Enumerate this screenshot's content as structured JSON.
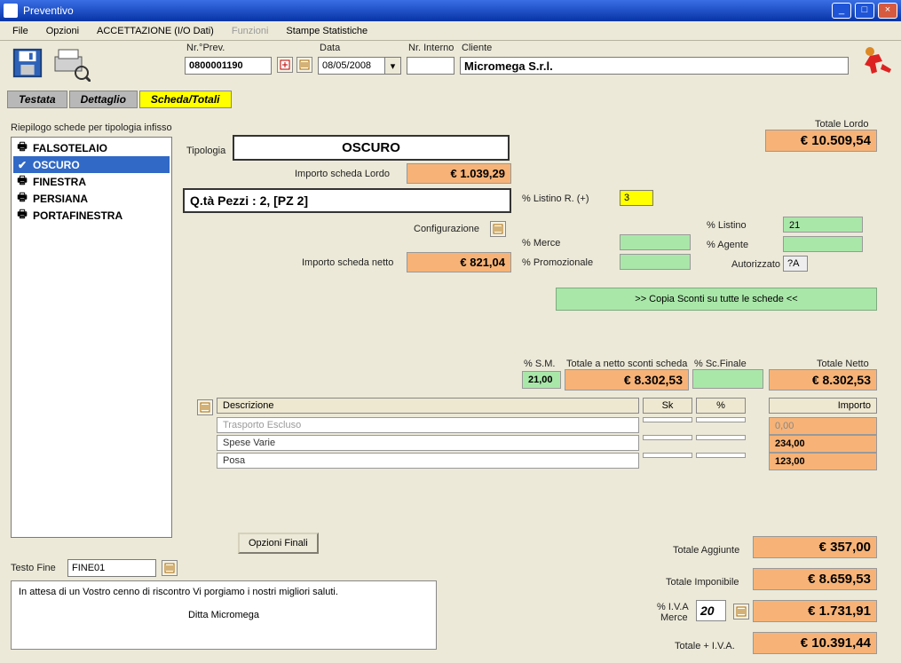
{
  "window": {
    "title": "Preventivo"
  },
  "menu": {
    "file": "File",
    "opzioni": "Opzioni",
    "accett": "ACCETTAZIONE (I/O Dati)",
    "funzioni": "Funzioni",
    "stampe": "Stampe Statistiche"
  },
  "top": {
    "nr_prev_label": "Nr.°Prev.",
    "nr_prev": "0800001190",
    "data_label": "Data",
    "data": "08/05/2008",
    "nr_interno_label": "Nr. Interno",
    "nr_interno": "",
    "cliente_label": "Cliente",
    "cliente": "Micromega S.r.l."
  },
  "tabs": {
    "testata": "Testata",
    "dettaglio": "Dettaglio",
    "scheda": "Scheda/Totali"
  },
  "sidebar": {
    "title": "Riepilogo schede per tipologia infisso",
    "items": [
      "FALSOTELAIO",
      "OSCURO",
      "FINESTRA",
      "PERSIANA",
      "PORTAFINESTRA"
    ],
    "selected_index": 1
  },
  "scheda": {
    "tipologia_label": "Tipologia",
    "tipologia": "OSCURO",
    "imp_lordo_label": "Importo scheda Lordo",
    "imp_lordo": "€ 1.039,29",
    "qta": "Q.tà Pezzi : 2,  [PZ 2]",
    "configurazione": "Configurazione",
    "imp_netto_label": "Importo scheda netto",
    "imp_netto": "€ 821,04"
  },
  "sconti": {
    "listino_r_label": "% Listino R. (+)",
    "listino_r": "3",
    "merce_label": "% Merce",
    "merce": "",
    "promoz_label": "% Promozionale",
    "promoz": "",
    "listino_label": "% Listino",
    "listino": "21",
    "agente_label": "% Agente",
    "agente": "",
    "autoriz_label": "Autorizzato",
    "autoriz": "?A",
    "copia": ">> Copia Sconti su tutte le schede <<"
  },
  "totali_riga": {
    "sm_label": "% S.M.",
    "sm": "21,00",
    "netto_scheda_label": "Totale a netto sconti scheda",
    "netto_scheda": "€ 8.302,53",
    "sc_finale_label": "% Sc.Finale",
    "sc_finale": "",
    "netto_label": "Totale Netto",
    "netto": "€ 8.302,53"
  },
  "tot_lordo": {
    "label": "Totale Lordo",
    "value": "€ 10.509,54"
  },
  "desc_table": {
    "col_desc": "Descrizione",
    "col_sk": "Sk",
    "col_pct": "%",
    "col_imp": "Importo",
    "rows": [
      {
        "desc": "Trasporto Escluso",
        "sk": "",
        "pct": "",
        "imp": "0,00",
        "grey": true
      },
      {
        "desc": "Spese Varie",
        "sk": "",
        "pct": "",
        "imp": "234,00"
      },
      {
        "desc": "Posa",
        "sk": "",
        "pct": "",
        "imp": "123,00"
      }
    ]
  },
  "footer": {
    "opzioni_finali": "Opzioni Finali",
    "testo_fine_label": "Testo Fine",
    "testo_fine": "FINE01",
    "line1": "In attesa di un Vostro cenno di riscontro Vi porgiamo i nostri migliori saluti.",
    "line2": "Ditta Micromega"
  },
  "final_totals": {
    "aggiunte_label": "Totale Aggiunte",
    "aggiunte": "€ 357,00",
    "imponibile_label": "Totale Imponibile",
    "imponibile": "€ 8.659,53",
    "iva_pct_label1": "% I.V.A",
    "iva_pct_label2": "Merce",
    "iva_pct": "20",
    "iva": "€ 1.731,91",
    "totiva_label": "Totale + I.V.A.",
    "totiva": "€ 10.391,44"
  }
}
